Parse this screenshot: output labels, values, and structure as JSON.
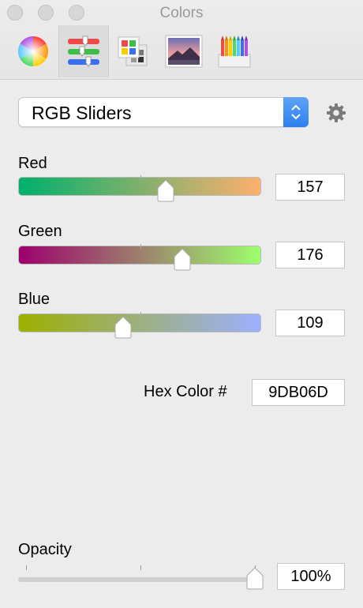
{
  "window": {
    "title": "Colors"
  },
  "tabs": [
    {
      "name": "color-wheel"
    },
    {
      "name": "color-sliders",
      "selected": true
    },
    {
      "name": "color-palettes"
    },
    {
      "name": "image-palettes"
    },
    {
      "name": "pencils"
    }
  ],
  "mode_popup": {
    "label": "RGB Sliders"
  },
  "sliders": [
    {
      "label": "Red",
      "value": "157",
      "level": 157,
      "max": 255,
      "gradient": [
        "#00b06d",
        "#ffb06d"
      ]
    },
    {
      "label": "Green",
      "value": "176",
      "level": 176,
      "max": 255,
      "gradient": [
        "#9d006d",
        "#9dff6d"
      ]
    },
    {
      "label": "Blue",
      "value": "109",
      "level": 109,
      "max": 255,
      "gradient": [
        "#9db000",
        "#9db0ff"
      ]
    }
  ],
  "hex": {
    "label": "Hex Color #",
    "value": "9DB06D"
  },
  "opacity": {
    "label": "Opacity",
    "value": "100%",
    "level": 1.0
  },
  "colors": {
    "accent": "#2d7ff1"
  }
}
